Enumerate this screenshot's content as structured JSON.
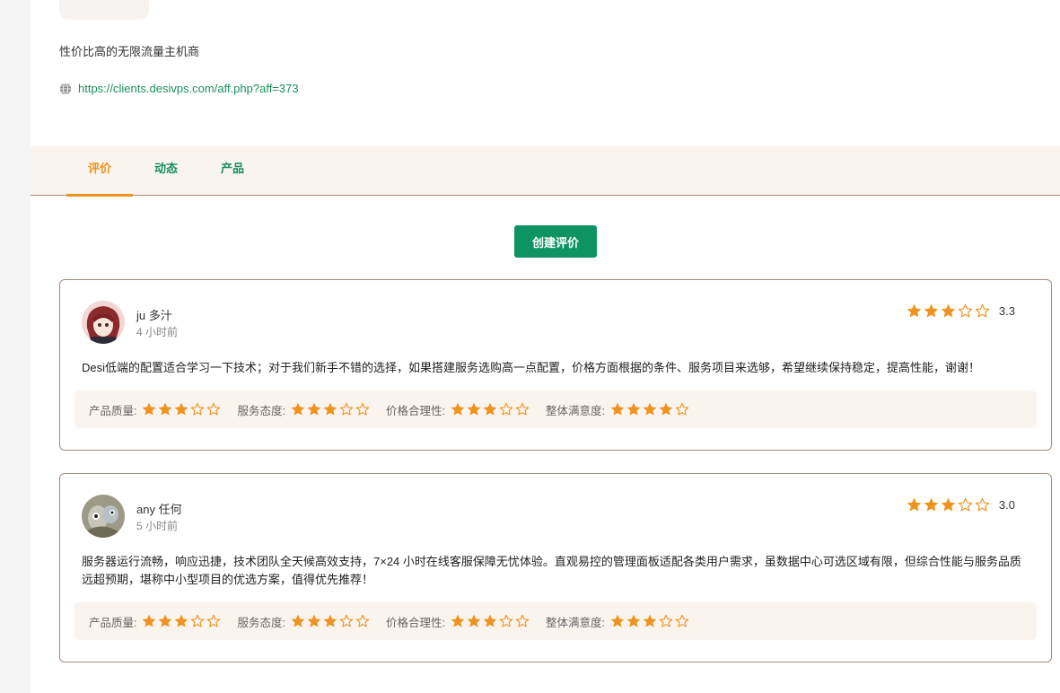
{
  "provider": {
    "description": "性价比高的无限流量主机商",
    "url": "https://clients.desivps.com/aff.php?aff=373"
  },
  "tabs": [
    {
      "label": "评价",
      "active": true
    },
    {
      "label": "动态",
      "active": false
    },
    {
      "label": "产品",
      "active": false
    }
  ],
  "create_button": "创建评价",
  "colors": {
    "accent": "#f0921e",
    "green": "#0e9462",
    "link": "#1a8f5c"
  },
  "rating_labels": [
    "产品质量:",
    "服务态度:",
    "价格合理性:",
    "整体满意度:"
  ],
  "reviews": [
    {
      "name": "ju  多汁",
      "time": "4 小时前",
      "score": "3.3",
      "stars": 3,
      "content": "Desi低端的配置适合学习一下技术；对于我们新手不错的选择，如果搭建服务选购高一点配置，价格方面根据的条件、服务项目来选够，希望继续保持稳定，提高性能，谢谢！",
      "ratings": [
        3,
        3,
        3,
        4
      ]
    },
    {
      "name": "any  任何",
      "time": "5 小时前",
      "score": "3.0",
      "stars": 3,
      "content": "服务器运行流畅，响应迅捷，技术团队全天候高效支持，7×24 小时在线客服保障无忧体验。直观易控的管理面板适配各类用户需求，虽数据中心可选区域有限，但综合性能与服务品质远超预期，堪称中小型项目的优选方案，值得优先推荐！",
      "ratings": [
        3,
        3,
        3,
        3
      ]
    }
  ]
}
